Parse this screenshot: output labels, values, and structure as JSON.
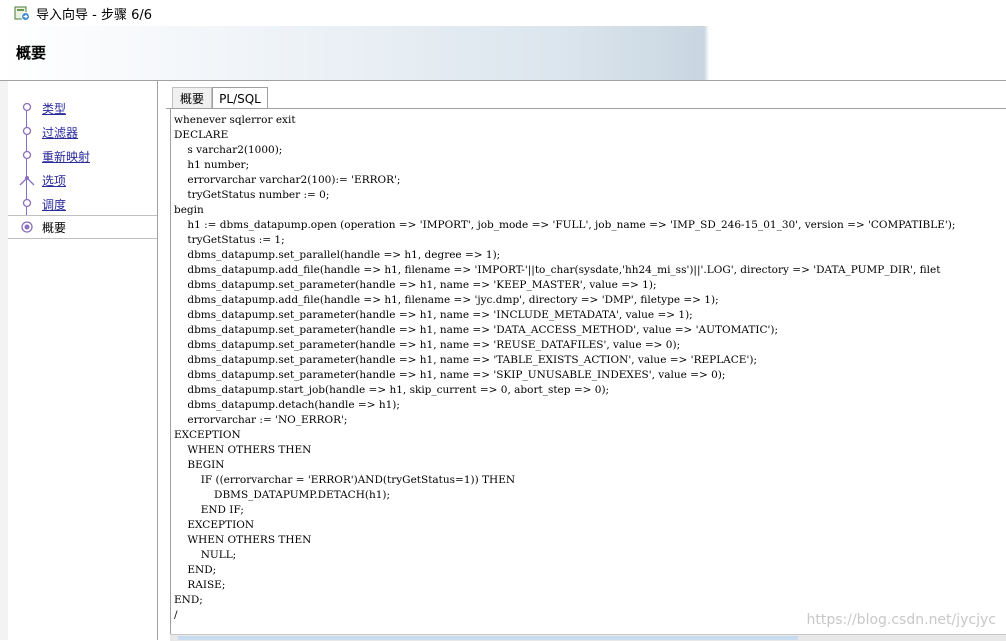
{
  "window": {
    "title": "导入向导 - 步骤 6/6",
    "icon": "import-wizard-icon"
  },
  "header": {
    "title": "概要"
  },
  "nav": {
    "items": [
      {
        "label": "类型",
        "state": "visited"
      },
      {
        "label": "过滤器",
        "state": "visited"
      },
      {
        "label": "重新映射",
        "state": "visited"
      },
      {
        "label": "选项",
        "state": "visited"
      },
      {
        "label": "调度",
        "state": "visited"
      },
      {
        "label": "概要",
        "state": "current"
      }
    ]
  },
  "tabs": [
    {
      "label": "概要",
      "selected": false
    },
    {
      "label": "PL/SQL",
      "selected": true
    }
  ],
  "code": {
    "lines": [
      "whenever sqlerror exit",
      "DECLARE",
      "    s varchar2(1000);",
      "    h1 number;",
      "    errorvarchar varchar2(100):= 'ERROR';",
      "    tryGetStatus number := 0;",
      "begin",
      "    h1 := dbms_datapump.open (operation => 'IMPORT', job_mode => 'FULL', job_name => 'IMP_SD_246-15_01_30', version => 'COMPATIBLE');",
      "    tryGetStatus := 1;",
      "    dbms_datapump.set_parallel(handle => h1, degree => 1);",
      "    dbms_datapump.add_file(handle => h1, filename => 'IMPORT-'||to_char(sysdate,'hh24_mi_ss')||'.LOG', directory => 'DATA_PUMP_DIR', filet",
      "    dbms_datapump.set_parameter(handle => h1, name => 'KEEP_MASTER', value => 1);",
      "    dbms_datapump.add_file(handle => h1, filename => 'jyc.dmp', directory => 'DMP', filetype => 1);",
      "    dbms_datapump.set_parameter(handle => h1, name => 'INCLUDE_METADATA', value => 1);",
      "    dbms_datapump.set_parameter(handle => h1, name => 'DATA_ACCESS_METHOD', value => 'AUTOMATIC');",
      "    dbms_datapump.set_parameter(handle => h1, name => 'REUSE_DATAFILES', value => 0);",
      "    dbms_datapump.set_parameter(handle => h1, name => 'TABLE_EXISTS_ACTION', value => 'REPLACE');",
      "    dbms_datapump.set_parameter(handle => h1, name => 'SKIP_UNUSABLE_INDEXES', value => 0);",
      "    dbms_datapump.start_job(handle => h1, skip_current => 0, abort_step => 0);",
      "    dbms_datapump.detach(handle => h1);",
      "    errorvarchar := 'NO_ERROR';",
      "EXCEPTION",
      "    WHEN OTHERS THEN",
      "    BEGIN",
      "        IF ((errorvarchar = 'ERROR')AND(tryGetStatus=1)) THEN",
      "            DBMS_DATAPUMP.DETACH(h1);",
      "        END IF;",
      "    EXCEPTION",
      "    WHEN OTHERS THEN",
      "        NULL;",
      "    END;",
      "    RAISE;",
      "END;",
      "/"
    ]
  },
  "watermark": "https://blog.csdn.net/jycjyc",
  "colors": {
    "nav_link": "#2a2a9c",
    "nav_marker": "#8a6ec0",
    "border": "#a0a0a0"
  }
}
